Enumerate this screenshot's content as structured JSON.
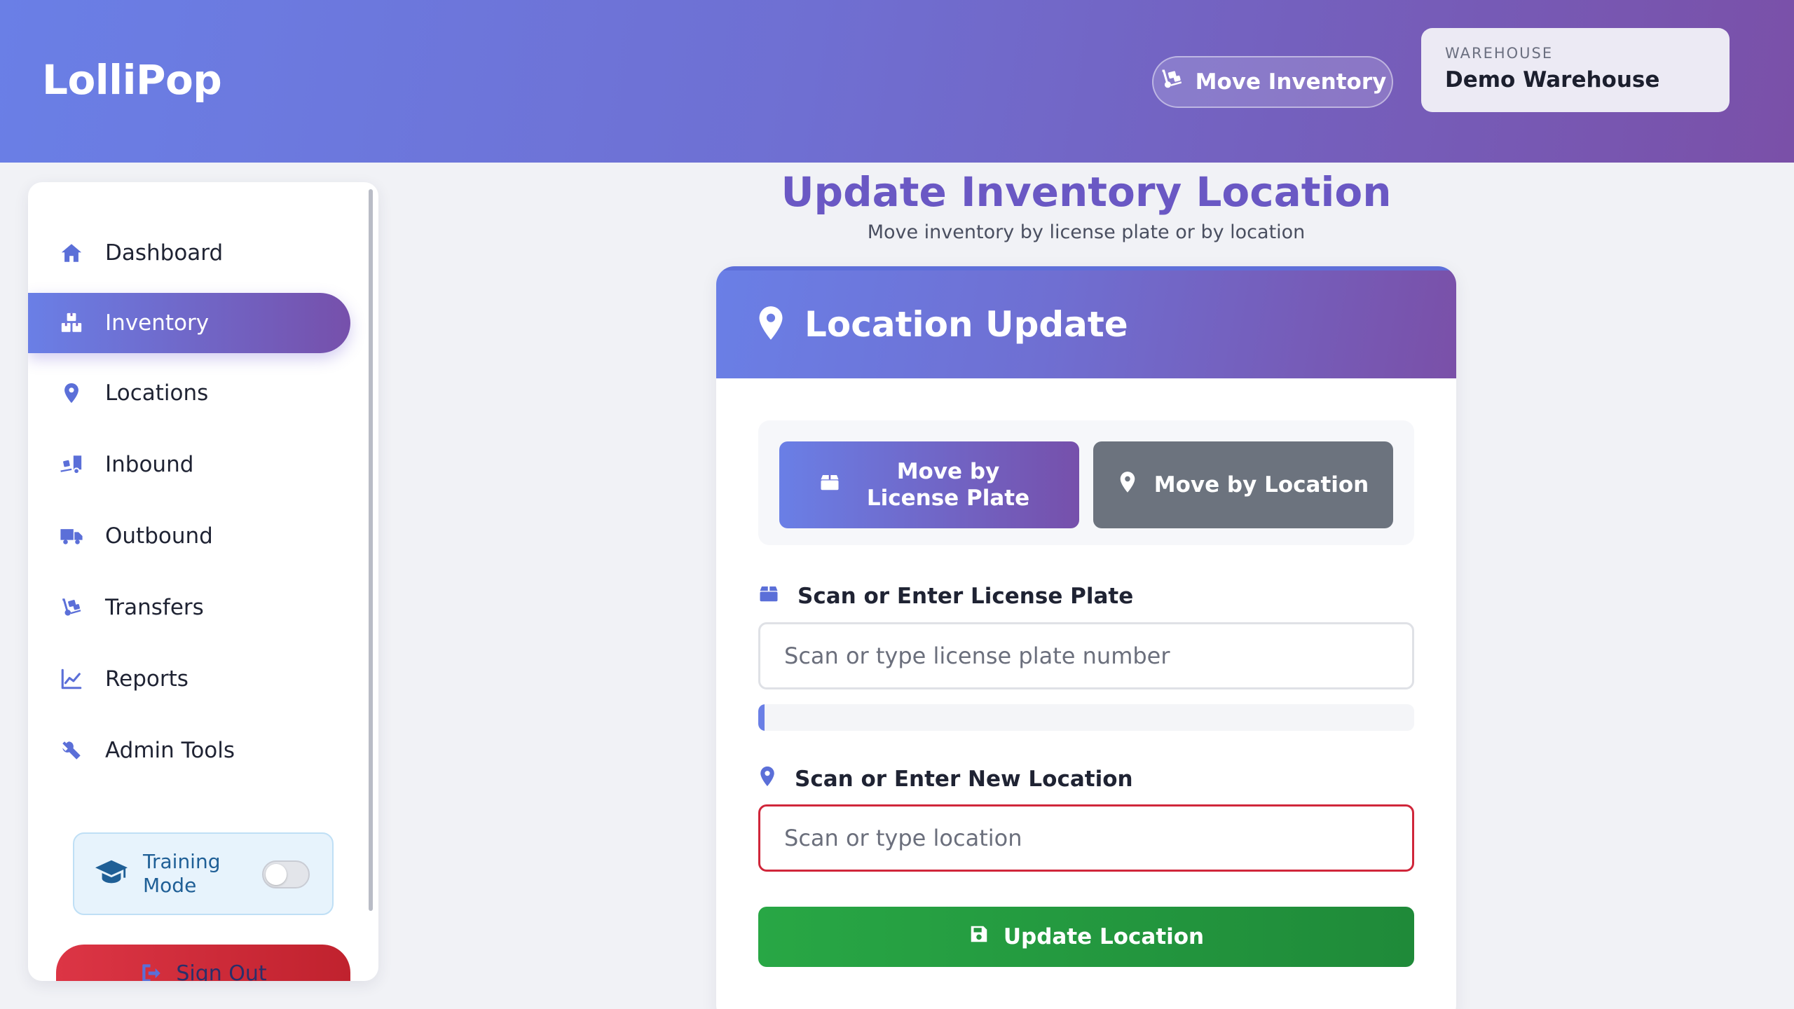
{
  "app": {
    "brand": "LolliPop",
    "header_button": {
      "label": "Move Inventory",
      "icon": "dolly-icon"
    },
    "warehouse": {
      "label": "WAREHOUSE",
      "name": "Demo Warehouse"
    }
  },
  "sidebar": {
    "items": [
      {
        "label": "Dashboard",
        "icon": "home-icon",
        "active": false
      },
      {
        "label": "Inventory",
        "icon": "boxes-icon",
        "active": true
      },
      {
        "label": "Locations",
        "icon": "map-pin-icon",
        "active": false
      },
      {
        "label": "Inbound",
        "icon": "truck-loading-icon",
        "active": false
      },
      {
        "label": "Outbound",
        "icon": "truck-icon",
        "active": false
      },
      {
        "label": "Transfers",
        "icon": "dolly-icon",
        "active": false
      },
      {
        "label": "Reports",
        "icon": "chart-line-icon",
        "active": false
      },
      {
        "label": "Admin Tools",
        "icon": "tools-icon",
        "active": false
      }
    ],
    "training": {
      "label": "Training Mode",
      "icon": "graduation-cap-icon",
      "enabled": false
    },
    "sign_out": {
      "label": "Sign Out",
      "icon": "sign-out-icon"
    }
  },
  "main": {
    "title": "Update Inventory Location",
    "subtitle": "Move inventory by license plate or by location",
    "card": {
      "title": "Location Update",
      "icon": "map-pin-icon",
      "modes": [
        {
          "label": "Move by License Plate",
          "icon": "box-icon",
          "selected": true
        },
        {
          "label": "Move by Location",
          "icon": "map-pin-icon",
          "selected": false
        }
      ],
      "license_plate": {
        "label": "Scan or Enter License Plate",
        "placeholder": "Scan or type license plate number",
        "value": "",
        "progress_fraction": 0.01
      },
      "new_location": {
        "label": "Scan or Enter New Location",
        "placeholder": "Scan or type location",
        "value": "",
        "invalid": true
      },
      "submit": {
        "label": "Update Location",
        "icon": "save-icon"
      }
    }
  },
  "colors": {
    "accent_start": "#6a7fe6",
    "accent_end": "#7650ab",
    "success": "#28a745",
    "danger": "#dc3545",
    "title": "#6a58c4"
  }
}
